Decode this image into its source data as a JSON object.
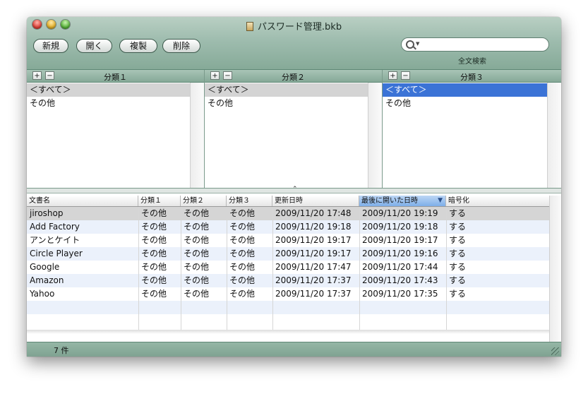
{
  "window": {
    "title": "パスワード管理.bkb"
  },
  "toolbar": {
    "buttons": [
      "新規",
      "開く",
      "複製",
      "削除"
    ],
    "search_value": "",
    "search_label": "全文検索"
  },
  "panes": [
    {
      "title": "分類１",
      "add": "+",
      "remove": "−",
      "items": [
        "＜すべて＞",
        "その他"
      ],
      "selected": 0,
      "selected_style": "gray"
    },
    {
      "title": "分類２",
      "add": "+",
      "remove": "−",
      "items": [
        "＜すべて＞",
        "その他"
      ],
      "selected": 0,
      "selected_style": "gray"
    },
    {
      "title": "分類３",
      "add": "+",
      "remove": "−",
      "items": [
        "＜すべて＞",
        "その他"
      ],
      "selected": 0,
      "selected_style": "blue"
    }
  ],
  "splitter_caret": "⌃",
  "table": {
    "columns": [
      "文書名",
      "分類１",
      "分類２",
      "分類３",
      "更新日時",
      "最後に開いた日時",
      "暗号化"
    ],
    "sorted_column": 5,
    "sort_indicator": "▼",
    "rows": [
      [
        "jiroshop",
        "その他",
        "その他",
        "その他",
        "2009/11/20 17:48",
        "2009/11/20 19:19",
        "する"
      ],
      [
        "Add Factory",
        "その他",
        "その他",
        "その他",
        "2009/11/20 19:18",
        "2009/11/20 19:18",
        "する"
      ],
      [
        "アンとケイト",
        "その他",
        "その他",
        "その他",
        "2009/11/20 19:17",
        "2009/11/20 19:17",
        "する"
      ],
      [
        "Circle Player",
        "その他",
        "その他",
        "その他",
        "2009/11/20 19:17",
        "2009/11/20 19:16",
        "する"
      ],
      [
        "Google",
        "その他",
        "その他",
        "その他",
        "2009/11/20 17:47",
        "2009/11/20 17:44",
        "する"
      ],
      [
        "Amazon",
        "その他",
        "その他",
        "その他",
        "2009/11/20 17:37",
        "2009/11/20 17:43",
        "する"
      ],
      [
        "Yahoo",
        "その他",
        "その他",
        "その他",
        "2009/11/20 17:37",
        "2009/11/20 17:35",
        "する"
      ]
    ],
    "selected_row": 0
  },
  "status": {
    "count": "7 件"
  },
  "colors": {
    "toolbar": "#9ebcae",
    "selection_blue": "#3b73d6",
    "row_stripe": "#ebf1fb",
    "selection_gray": "#d4d4d4"
  }
}
